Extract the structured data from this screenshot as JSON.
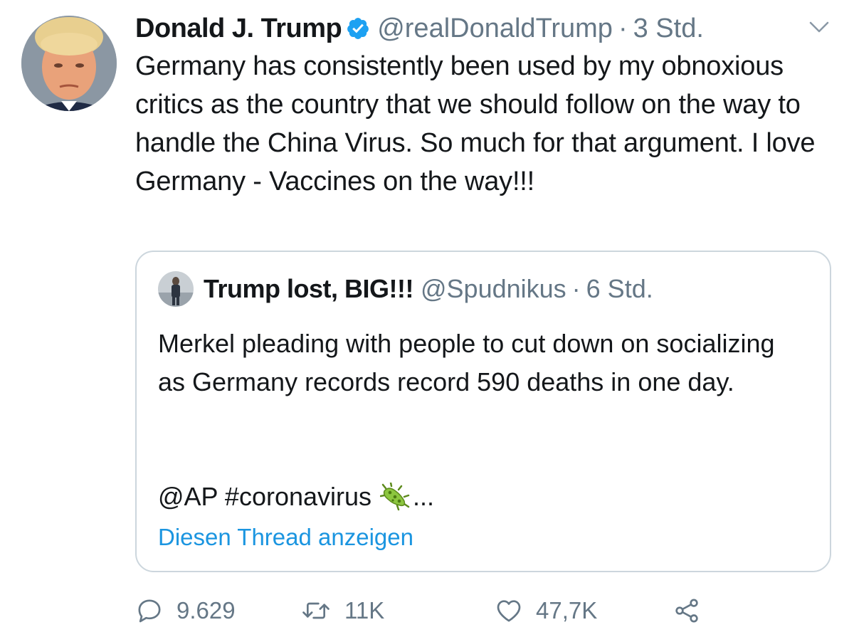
{
  "tweet": {
    "author_name": "Donald J. Trump",
    "author_handle": "@realDonaldTrump",
    "separator": "·",
    "time": "3 Std.",
    "text": "Germany has consistently been used by my obnoxious critics as the country that we should follow on the way to handle the China Virus. So much for that argument. I love Germany - Vaccines on the way!!!",
    "verified_icon": "verified-badge-icon",
    "menu_icon": "chevron-down-icon"
  },
  "quote": {
    "author_name": "Trump lost, BIG!!!",
    "author_handle": "@Spudnikus",
    "separator": "·",
    "time": "6 Std.",
    "text": "Merkel pleading with people to cut down on socializing as Germany records record 590 deaths in one day.",
    "tags": "@AP #coronavirus",
    "emoji_icon": "microbe-emoji-icon",
    "ellipsis": "...",
    "show_thread": "Diesen Thread anzeigen"
  },
  "actions": {
    "reply_count": "9.629",
    "retweet_count": "11K",
    "like_count": "47,7K",
    "reply_icon": "reply-icon",
    "retweet_icon": "retweet-icon",
    "like_icon": "heart-icon",
    "share_icon": "share-icon"
  },
  "colors": {
    "text": "#14171a",
    "secondary": "#657786",
    "link": "#1b95e0",
    "verified": "#1da1f2",
    "border": "#ccd6dd"
  }
}
